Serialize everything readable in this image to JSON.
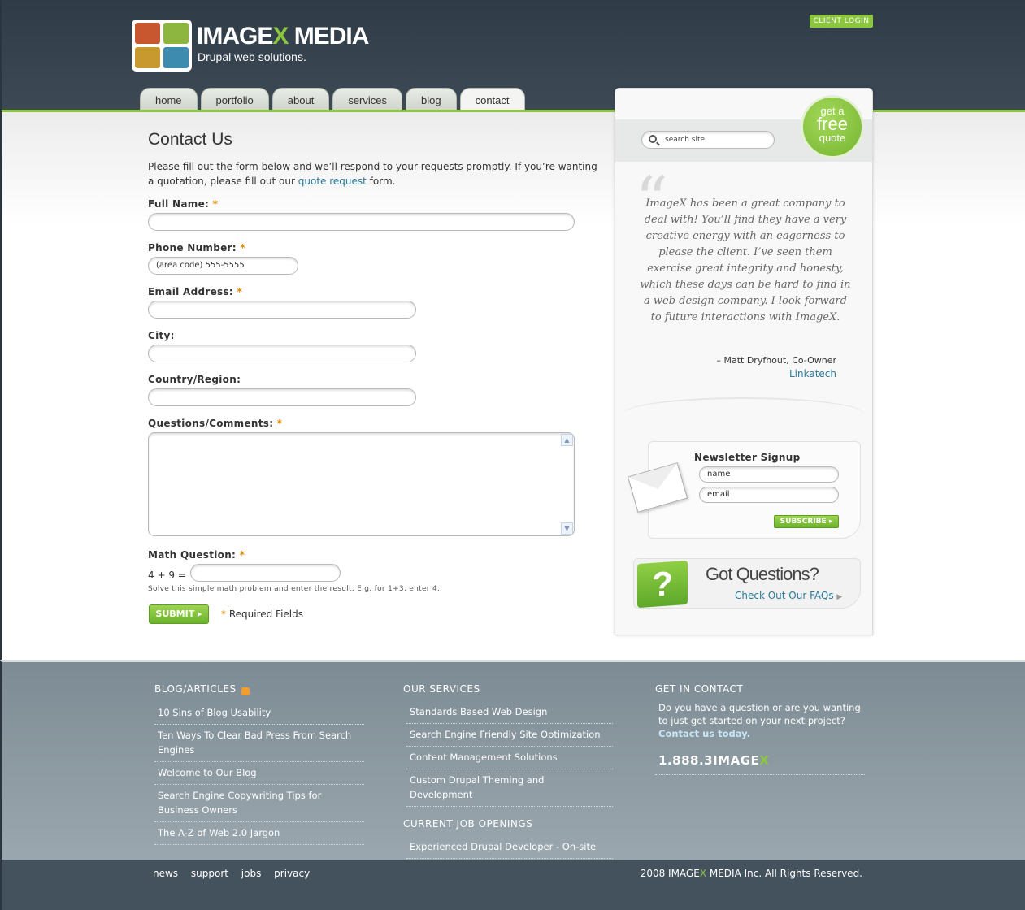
{
  "brand": {
    "logo_main": "IMAGE",
    "logo_x": "X",
    "logo_rest": " MEDIA",
    "tagline": "Drupal web solutions.",
    "colors": {
      "green": "#8cc63f",
      "header": "#2f3c47"
    }
  },
  "client_login": "CLIENT LOGIN",
  "nav": {
    "tabs": [
      {
        "label": "home"
      },
      {
        "label": "portfolio"
      },
      {
        "label": "about"
      },
      {
        "label": "services"
      },
      {
        "label": "blog"
      },
      {
        "label": "contact"
      }
    ],
    "active": "contact"
  },
  "contact": {
    "title": "Contact Us",
    "intro_before": "Please fill out the form below and we’ll respond to your requests promptly. If you’re wanting a quotation, please fill out our ",
    "intro_link": "quote request",
    "intro_after": " form.",
    "required_marker": "*",
    "fields": {
      "full_name": {
        "label": "Full Name:"
      },
      "phone": {
        "label": "Phone Number:",
        "value": "(area code) 555-5555"
      },
      "email": {
        "label": "Email Address:"
      },
      "city": {
        "label": "City:"
      },
      "country": {
        "label": "Country/Region:"
      },
      "questions": {
        "label": "Questions/Comments:"
      },
      "math": {
        "label": "Math Question:",
        "equation": "4 + 9 =",
        "hint": "Solve this simple math problem and enter the result. E.g. for 1+3, enter 4."
      }
    },
    "submit_label": "SUBMIT",
    "required_note": "Required Fields"
  },
  "sidebar": {
    "search_placeholder": "search site",
    "quote_btn": {
      "line1": "get a",
      "line2": "free",
      "line3": "quote"
    },
    "testimonial": {
      "text": "ImageX has been a great company to deal with! You’ll find they have a very creative energy with an eagerness to please the client. I’ve seen them exercise great integrity and honesty, which these days can be hard to find in a web design company. I look forward to future interactions with ImageX.",
      "author": "– Matt Dryfhout, Co-Owner",
      "company": "Linkatech"
    },
    "newsletter": {
      "title": "Newsletter Signup",
      "name_placeholder": "name",
      "email_placeholder": "email",
      "subscribe_label": "SUBSCRIBE"
    },
    "questions": {
      "title": "Got Questions?",
      "link": "Check Out Our FAQs",
      "icon_glyph": "?"
    }
  },
  "footer": {
    "blog": {
      "heading": "BLOG/ARTICLES",
      "items": [
        {
          "label": "10 Sins of Blog Usability"
        },
        {
          "label": "Ten Ways To Clear Bad Press From Search Engines"
        },
        {
          "label": "Welcome to Our Blog"
        },
        {
          "label": "Search Engine Copywriting Tips for Business Owners"
        },
        {
          "label": "The A-Z of Web 2.0 Jargon"
        }
      ]
    },
    "services": {
      "heading": "OUR SERVICES",
      "items": [
        {
          "label": "Standards Based Web Design"
        },
        {
          "label": "Search Engine Friendly Site Optimization"
        },
        {
          "label": "Content Management Solutions"
        },
        {
          "label": "Custom Drupal Theming and Development"
        }
      ]
    },
    "jobs": {
      "heading": "CURRENT JOB OPENINGS",
      "items": [
        {
          "label": "Experienced Drupal Developer - On-site"
        }
      ]
    },
    "contact": {
      "heading": "GET IN CONTACT",
      "text": "Do you have a question or are you wanting to just get started on your next project?",
      "link": "Contact us today.",
      "phone_main": "1.888.3IMAGE",
      "phone_x": "X"
    },
    "bottom_nav": [
      {
        "label": "news"
      },
      {
        "label": "support"
      },
      {
        "label": "jobs"
      },
      {
        "label": "privacy"
      }
    ],
    "copyright_before": "2008 IMAGE",
    "copyright_x": "X",
    "copyright_after": " MEDIA Inc. All Rights Reserved."
  }
}
